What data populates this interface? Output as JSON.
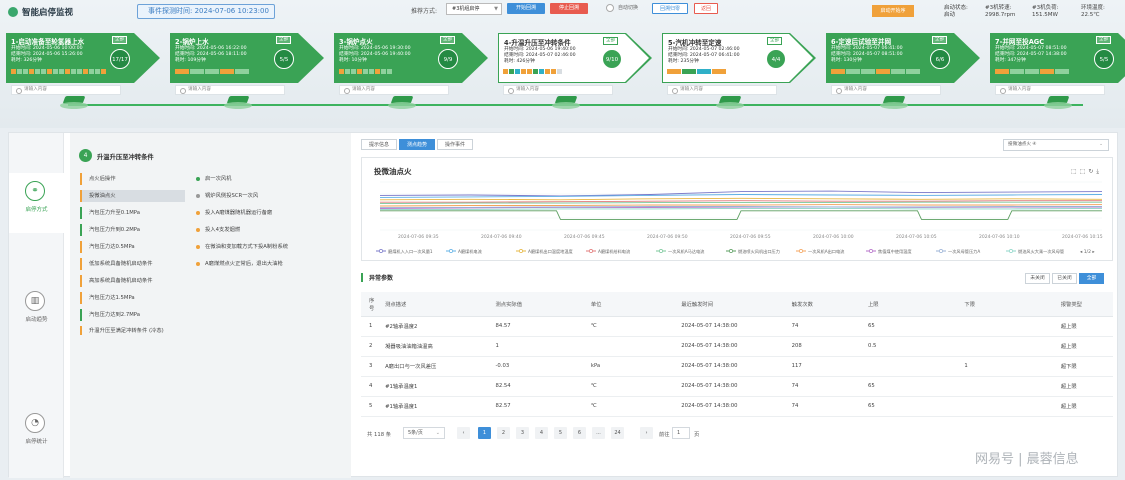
{
  "header": {
    "title": "智能启停监视",
    "event_time": "事件探测时间: 2024-07-06 10:23:00",
    "push_label": "推荐方式:",
    "unit_select": "#3机组启停",
    "btn_start": "开始回溯",
    "btn_stop": "停止回溯",
    "auto_label": "自动切换",
    "btn_reset": "回溯归零",
    "btn_back": "返回",
    "warn_btn": "启动开始序",
    "stats": [
      {
        "label": "启动状态:",
        "value": "启动"
      },
      {
        "label": "#3机转速:",
        "value": "2998.7rpm"
      },
      {
        "label": "#3机负荷:",
        "value": "151.5MW"
      },
      {
        "label": "环境温度:",
        "value": "22.5℃"
      }
    ],
    "colors": {
      "accent": "#3aa355",
      "primary": "#3e8fd9",
      "danger": "#e85b4f",
      "warning": "#f0a13a"
    }
  },
  "stages": [
    {
      "title": "1-启动准备至轮氢器上水",
      "tag": "全部",
      "l1": "开始时间: 2024-05-06 10:00:00",
      "l2": "结束时间: 2024-05-06 15:26:00",
      "l3": "耗时: 326分钟",
      "count": "17/17",
      "style": "green"
    },
    {
      "title": "2-锅炉上水",
      "tag": "全部",
      "l1": "开始时间: 2024-05-06 16:22:00",
      "l2": "结束时间: 2024-05-06 18:11:00",
      "l3": "耗时: 109分钟",
      "count": "5/5",
      "style": "green"
    },
    {
      "title": "3-锅炉点火",
      "tag": "全部",
      "l1": "开始时间: 2024-05-06 19:30:00",
      "l2": "结束时间: 2024-05-06 19:40:00",
      "l3": "耗时: 10分钟",
      "count": "9/9",
      "style": "green"
    },
    {
      "title": "4-升温升压至冲转条件",
      "tag": "全部",
      "l1": "开始时间: 2024-05-06 19:40:00",
      "l2": "结束时间: 2024-05-07 02:46:00",
      "l3": "耗时: 426分钟",
      "count": "9/10",
      "style": "white"
    },
    {
      "title": "5-汽机冲转至定速",
      "tag": "全部",
      "l1": "开始时间: 2024-05-07 02:46:00",
      "l2": "结束时间: 2024-05-07 06:41:00",
      "l3": "耗时: 235分钟",
      "count": "4/4",
      "style": "white"
    },
    {
      "title": "6-定速后试验至并网",
      "tag": "全部",
      "l1": "开始时间: 2024-05-07 06:41:00",
      "l2": "结束时间: 2024-05-07 08:51:00",
      "l3": "耗时: 130分钟",
      "count": "6/6",
      "style": "green"
    },
    {
      "title": "7-并网至投AGC",
      "tag": "全部",
      "l1": "开始时间: 2024-05-07 08:51:00",
      "l2": "结束时间: 2024-05-07 14:38:00",
      "l3": "耗时: 347分钟",
      "count": "5/5",
      "style": "green"
    }
  ],
  "note_placeholder": "请输入内容",
  "side": [
    {
      "label": "启停方式",
      "icon": "diagram-icon"
    },
    {
      "label": "启动趋势",
      "icon": "chart-icon"
    },
    {
      "label": "启停统计",
      "icon": "clock-icon"
    }
  ],
  "condition": {
    "num": "4",
    "title": "升温升压至冲转条件",
    "left_items": [
      "点火后操作",
      "投微油点火",
      "汽包压力升至0.1MPa",
      "汽包压力升到0.2MPa",
      "汽包压力达0.5MPa",
      "低加系统具备随机启动条件",
      "高加系统具备随机启动条件",
      "汽包压力达1.5MPa",
      "汽包压力达到2.7MPa",
      "升温升压至满足冲转条件 (冷态)"
    ],
    "right_items": [
      "启一次风机",
      "锅炉风侧投SCR一次风",
      "投入A磨煤器随机器运行备磨",
      "投入4支发烟燃",
      "在微油和变加载方式下投A制粉系统",
      "A磨煤燃点火正常后，退出大油枪"
    ]
  },
  "tabs": [
    "提示信息",
    "测点趋势",
    "操作事件"
  ],
  "trend_select": "投微油点火 ④",
  "chart_data": {
    "type": "line",
    "title": "投微油点火",
    "x": [
      "2024-07-06 09:35",
      "2024-07-06 09:40",
      "2024-07-06 09:45",
      "2024-07-06 09:50",
      "2024-07-06 09:55",
      "2024-07-06 10:00",
      "2024-07-06 10:05",
      "2024-07-06 10:10",
      "2024-07-06 10:15"
    ],
    "ylim": [
      0,
      100
    ],
    "series": [
      {
        "name": "磨煤机入入口一次风量1",
        "color": "#7a79c9",
        "values": [
          72,
          73,
          71,
          74,
          80,
          81,
          78,
          79,
          80
        ]
      },
      {
        "name": "A磨煤机电流",
        "color": "#5fb0e5",
        "values": [
          68,
          69,
          70,
          72,
          74,
          73,
          72,
          73,
          74
        ]
      },
      {
        "name": "A磨煤机出口温度地温度C",
        "color": "#e6b742",
        "values": [
          63,
          64,
          63,
          65,
          66,
          65,
          64,
          65,
          64
        ]
      },
      {
        "name": "A磨煤机给料电流",
        "color": "#e27a7a",
        "values": [
          58,
          58,
          59,
          60,
          61,
          60,
          60,
          61,
          61
        ]
      },
      {
        "name": "一次风机A马达电流",
        "color": "#78c79a",
        "values": [
          55,
          56,
          56,
          57,
          57,
          57,
          58,
          58,
          58
        ]
      },
      {
        "name": "燃油喷火风机出口压力",
        "color": "#5a9e5f",
        "values": [
          40,
          40,
          22,
          22,
          40,
          40,
          22,
          40,
          40
        ]
      },
      {
        "name": "一次风机A出口电流",
        "color": "#f4a35b",
        "values": [
          50,
          51,
          51,
          52,
          52,
          53,
          52,
          52,
          53
        ]
      },
      {
        "name": "焦值煤中使用温度",
        "color": "#b46fc8",
        "values": [
          45,
          46,
          47,
          47,
          48,
          48,
          47,
          48,
          48
        ]
      },
      {
        "name": "一次风母管压力A",
        "color": "#9ab2d6",
        "values": [
          47,
          47,
          48,
          49,
          49,
          48,
          48,
          49,
          49
        ]
      },
      {
        "name": "燃油风火大乘一次风母管压力1",
        "color": "#8ed6c8",
        "values": [
          43,
          43,
          44,
          44,
          45,
          45,
          44,
          44,
          45
        ]
      }
    ],
    "legend_page": "1/2"
  },
  "params": {
    "title": "异常参数",
    "toggles": [
      "未关闭",
      "已关闭",
      "全部"
    ],
    "columns": [
      "序号",
      "测点描述",
      "测点实际值",
      "单位",
      "最近触发时间",
      "触发次数",
      "上限",
      "下限",
      "报警类型"
    ],
    "rows": [
      [
        "1",
        "#2轴承温度2",
        "84.57",
        "℃",
        "2024-05-07 14:38:00",
        "74",
        "65",
        "",
        "超上限"
      ],
      [
        "2",
        "凝器吸油油箱油温高",
        "1",
        "",
        "2024-05-07 14:38:00",
        "208",
        "0.5",
        "",
        "超上限"
      ],
      [
        "3",
        "A磨出口与一次风差压",
        "-0.03",
        "kPa",
        "2024-05-07 14:38:00",
        "117",
        "",
        "1",
        "超下限"
      ],
      [
        "4",
        "#1轴承温度1",
        "82.54",
        "℃",
        "2024-05-07 14:38:00",
        "74",
        "65",
        "",
        "超上限"
      ],
      [
        "5",
        "#1轴承温度1",
        "82.57",
        "℃",
        "2024-05-07 14:38:00",
        "74",
        "65",
        "",
        "超上限"
      ]
    ]
  },
  "pagination": {
    "total": "共 118 条",
    "page_size": "5条/页",
    "pages": [
      "1",
      "2",
      "3",
      "4",
      "5",
      "6",
      "...",
      "24"
    ],
    "goto_label": "前往",
    "goto_value": "1",
    "goto_suffix": "页"
  },
  "watermark": "网易号 | 晨蓉信息"
}
